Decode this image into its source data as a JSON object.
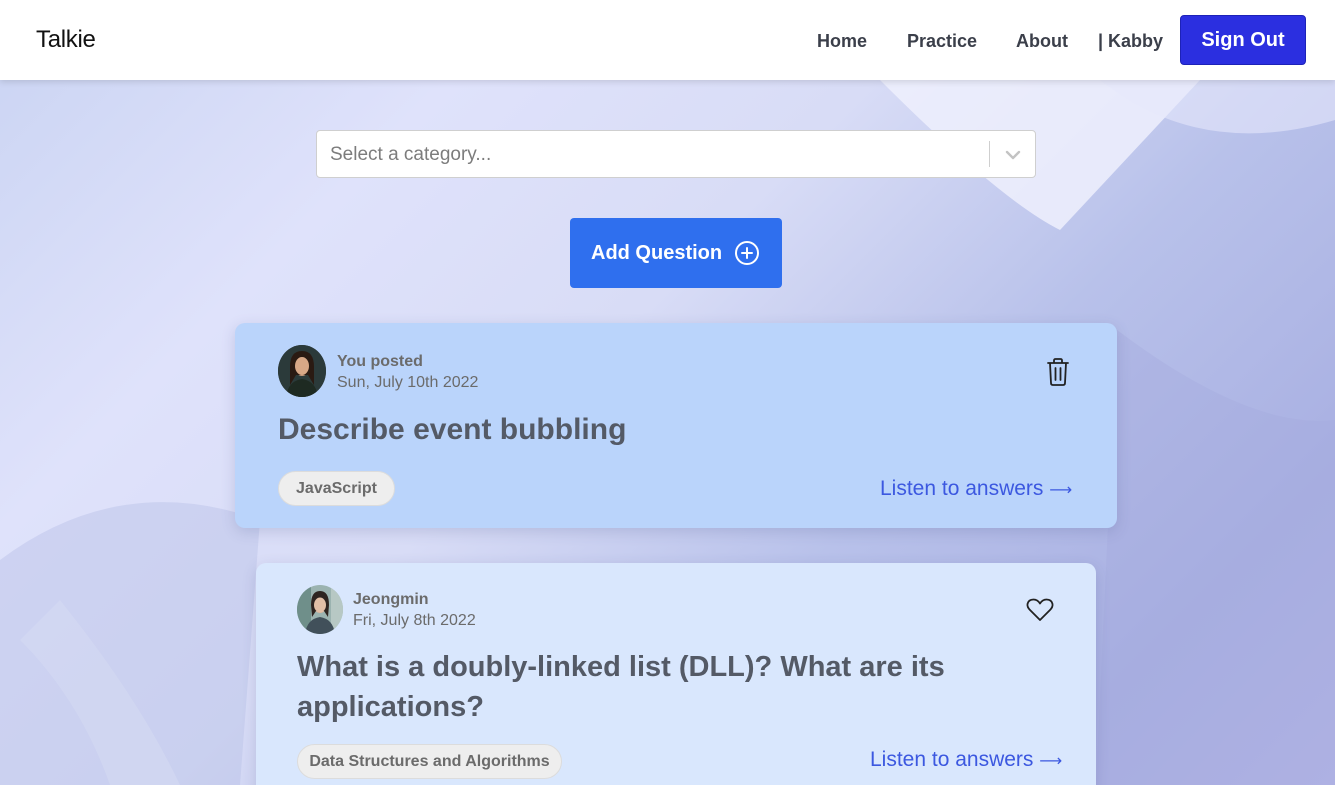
{
  "navbar": {
    "brand": "Talkie",
    "links": [
      "Home",
      "Practice",
      "About"
    ],
    "user": "| Kabby",
    "signout_label": "Sign Out"
  },
  "category_select": {
    "placeholder": "Select a category..."
  },
  "add_question": {
    "label": "Add Question"
  },
  "questions": [
    {
      "author": "You posted",
      "date": "Sun, July 10th 2022",
      "title": "Describe event bubbling",
      "tag": "JavaScript",
      "listen_label": "Listen to answers",
      "action_icon": "trash-icon"
    },
    {
      "author": "Jeongmin",
      "date": "Fri, July 8th 2022",
      "title": "What is a doubly-linked list (DLL)? What are its applications?",
      "tag": "Data Structures and Algorithms",
      "listen_label": "Listen to answers",
      "action_icon": "heart-icon"
    }
  ],
  "colors": {
    "accent": "#2f6fee",
    "signout": "#2b2fe0",
    "link": "#3c58e0",
    "card_own": "#bad4fb",
    "card_other": "#d9e7fd"
  }
}
